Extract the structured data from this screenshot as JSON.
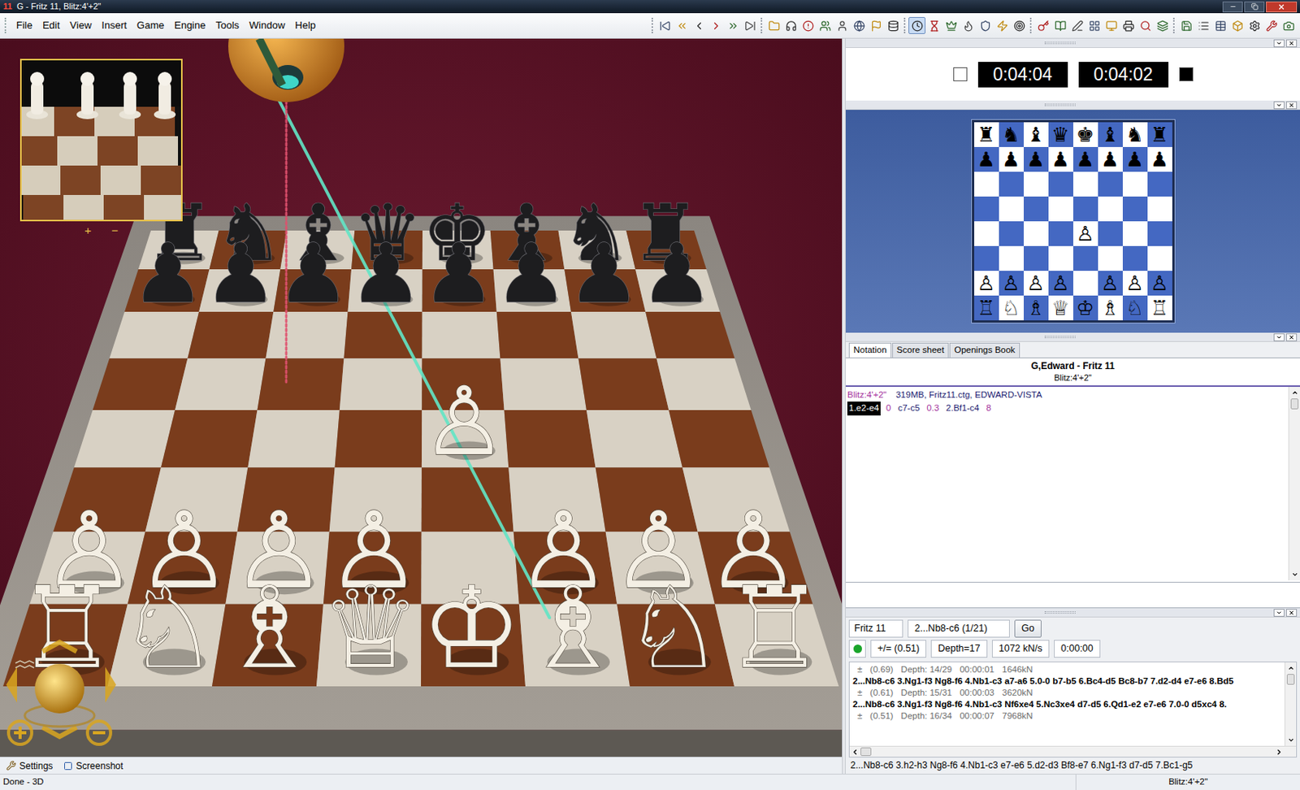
{
  "window": {
    "title": "G - Fritz 11, Blitz:4'+2\"",
    "app_icon": "11"
  },
  "menu": [
    "File",
    "Edit",
    "View",
    "Insert",
    "Game",
    "Engine",
    "Tools",
    "Window",
    "Help"
  ],
  "toolbar_groups": [
    [
      {
        "selected": false
      },
      {
        "selected": false
      },
      {
        "selected": false
      },
      {
        "selected": false
      },
      {
        "selected": false
      },
      {
        "selected": false
      }
    ],
    [
      {
        "selected": false
      },
      {
        "selected": false
      },
      {
        "selected": false
      },
      {
        "selected": false
      },
      {
        "selected": false
      },
      {
        "selected": false
      },
      {
        "selected": false
      },
      {
        "selected": false
      }
    ],
    [
      {
        "selected": true
      },
      {
        "selected": false
      },
      {
        "selected": false
      },
      {
        "selected": false
      },
      {
        "selected": false
      },
      {
        "selected": false
      },
      {
        "selected": false
      }
    ],
    [
      {
        "selected": false
      },
      {
        "selected": false
      },
      {
        "selected": false
      },
      {
        "selected": false
      },
      {
        "selected": false
      },
      {
        "selected": false
      },
      {
        "selected": false
      },
      {
        "selected": false
      }
    ],
    [
      {
        "selected": false
      },
      {
        "selected": false
      },
      {
        "selected": false
      },
      {
        "selected": false
      },
      {
        "selected": false
      },
      {
        "selected": false
      },
      {
        "selected": false
      }
    ]
  ],
  "board": [
    [
      "♜",
      "♞",
      "♝",
      "♛",
      "♚",
      "♝",
      "♞",
      "♜"
    ],
    [
      "♟",
      "♟",
      "♟",
      "♟",
      "♟",
      "♟",
      "♟",
      "♟"
    ],
    [
      "",
      "",
      "",
      "",
      "",
      "",
      "",
      ""
    ],
    [
      "",
      "",
      "",
      "",
      "",
      "",
      "",
      ""
    ],
    [
      "",
      "",
      "",
      "",
      "♙",
      "",
      "",
      ""
    ],
    [
      "",
      "",
      "",
      "",
      "",
      "",
      "",
      ""
    ],
    [
      "♙",
      "♙",
      "♙",
      "♙",
      "",
      "♙",
      "♙",
      "♙"
    ],
    [
      "♖",
      "♘",
      "♗",
      "♕",
      "♔",
      "♗",
      "♘",
      "♖"
    ]
  ],
  "view3d": {
    "inset_zoom": [
      "+",
      "−"
    ],
    "beams": [
      {
        "target": "f1",
        "color": "#62e6c6",
        "kind": "solid"
      },
      {
        "target": "c5",
        "color": "#e0506e",
        "kind": "dotted"
      }
    ]
  },
  "bottom_tools": [
    "Settings",
    "Screenshot"
  ],
  "status_bar": {
    "left": "Done - 3D",
    "right": "Blitz:4'+2\""
  },
  "clocks": [
    {
      "time": "0:04:04",
      "side": "white"
    },
    {
      "time": "0:04:02",
      "side": "black"
    }
  ],
  "notation": {
    "tabs": [
      {
        "label": "Notation",
        "selected": true
      },
      {
        "label": "Score sheet",
        "selected": false
      },
      {
        "label": "Openings Book",
        "selected": false
      }
    ],
    "players": "G,Edward - Fritz 11",
    "event": "Blitz:4'+2\"",
    "info": [
      {
        "text": "Blitz:4'+2\"",
        "color": "#a3309c"
      },
      {
        "text": "319MB, Fritz11.ctg, EDWARD-VISTA",
        "color": "#1b1b70"
      }
    ],
    "moves": [
      {
        "text": "1.e2-e4",
        "kind": "move",
        "selected": true
      },
      {
        "text": "0",
        "kind": "time",
        "selected": false
      },
      {
        "text": "c7-c5",
        "kind": "move",
        "selected": false
      },
      {
        "text": "0.3",
        "kind": "time",
        "selected": false
      },
      {
        "text": "2.Bf1-c4",
        "kind": "move",
        "selected": false
      },
      {
        "text": "8",
        "kind": "time",
        "selected": false
      }
    ]
  },
  "engine": {
    "name": "Fritz 11",
    "current": "2...Nb8-c6 (1/21)",
    "go": "Go",
    "running": true,
    "eval": "+/= (0.51)",
    "depth": "Depth=17",
    "speed": "1072 kN/s",
    "time": "0:00:00",
    "lines": [
      {
        "kind": "info",
        "symbol": "±",
        "eval": "(0.69)",
        "depth": "Depth: 14/29",
        "time": "00:00:01",
        "nodes": "1646kN"
      },
      {
        "kind": "line",
        "text": "2...Nb8-c6 3.Ng1-f3 Ng8-f6 4.Nb1-c3 a7-a6 5.0-0 b7-b5 6.Bc4-d5 Bc8-b7 7.d2-d4 e7-e6 8.Bd5"
      },
      {
        "kind": "info",
        "symbol": "±",
        "eval": "(0.61)",
        "depth": "Depth: 15/31",
        "time": "00:00:03",
        "nodes": "3620kN"
      },
      {
        "kind": "line",
        "text": "2...Nb8-c6 3.Ng1-f3 Ng8-f6 4.Nb1-c3 Nf6xe4 5.Nc3xe4 d7-d5 6.Qd1-e2 e7-e6 7.0-0 d5xc4 8."
      },
      {
        "kind": "info",
        "symbol": "±",
        "eval": "(0.51)",
        "depth": "Depth: 16/34",
        "time": "00:00:07",
        "nodes": "7968kN"
      }
    ],
    "bottom_line": "2...Nb8-c6 3.h2-h3 Ng8-f6 4.Nb1-c3 e7-e6 5.d2-d3 Bf8-e7 6.Ng1-f3 d7-d5 7.Bc1-g5"
  }
}
